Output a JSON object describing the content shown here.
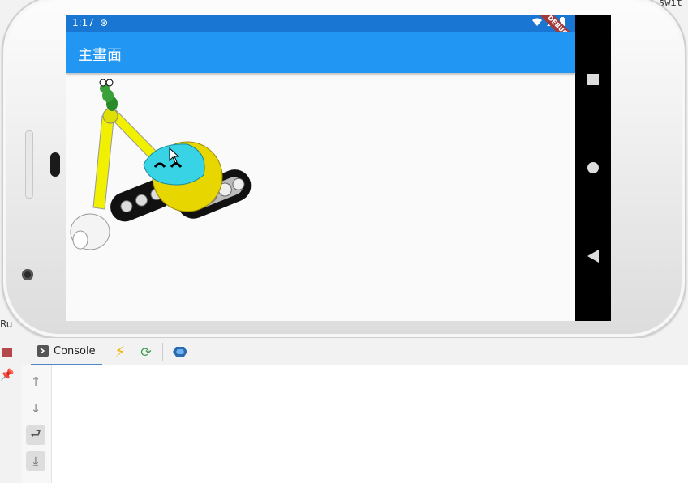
{
  "ide": {
    "top_right_fragment": "swit",
    "run_label": "Ru"
  },
  "phone": {
    "status_bar": {
      "time": "1:17",
      "debug_banner": "DEBUG"
    },
    "app_bar": {
      "title": "主畫面"
    },
    "colors": {
      "app_bar": "#2196f3",
      "status_bar": "#1976d2"
    }
  },
  "run_window": {
    "tab_label": "Console",
    "toolbar_icons": [
      "hot-reload-icon",
      "hot-restart-icon",
      "devtools-icon"
    ],
    "side_icons": [
      "arrow-up-icon",
      "arrow-down-icon",
      "soft-wrap-icon",
      "scroll-to-end-icon"
    ]
  }
}
